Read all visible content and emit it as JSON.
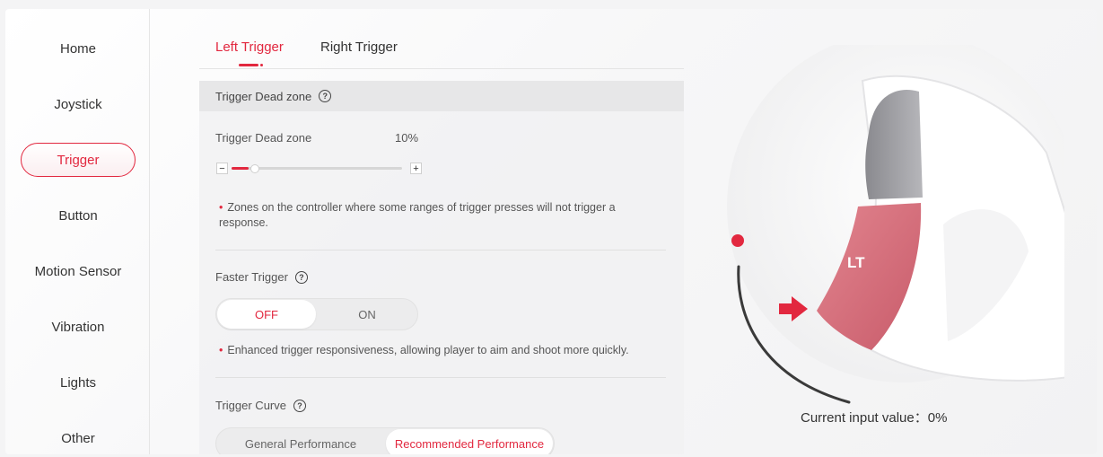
{
  "sidebar": {
    "items": [
      {
        "label": "Home"
      },
      {
        "label": "Joystick"
      },
      {
        "label": "Trigger"
      },
      {
        "label": "Button"
      },
      {
        "label": "Motion Sensor"
      },
      {
        "label": "Vibration"
      },
      {
        "label": "Lights"
      },
      {
        "label": "Other"
      }
    ],
    "active": "Trigger"
  },
  "tabs": [
    {
      "label": "Left Trigger"
    },
    {
      "label": "Right Trigger"
    }
  ],
  "dead_zone": {
    "section_title": "Trigger Dead zone",
    "label": "Trigger Dead zone",
    "value": "10%",
    "level": 0.1,
    "minus": "−",
    "plus": "+",
    "note": "Zones on the controller where some ranges of trigger presses will not trigger a response."
  },
  "faster_trigger": {
    "title": "Faster Trigger",
    "off": "OFF",
    "on": "ON",
    "selected": "OFF",
    "note": "Enhanced trigger responsiveness, allowing player to aim and shoot more quickly."
  },
  "trigger_curve": {
    "title": "Trigger Curve",
    "options": [
      "General Performance",
      "Recommended Performance"
    ],
    "selected": "Recommended Performance"
  },
  "illustration": {
    "trigger_label": "LT",
    "readout": "Current input value：0%"
  },
  "colors": {
    "accent": "#e2283f",
    "trigger_pink": "#d9707f"
  }
}
